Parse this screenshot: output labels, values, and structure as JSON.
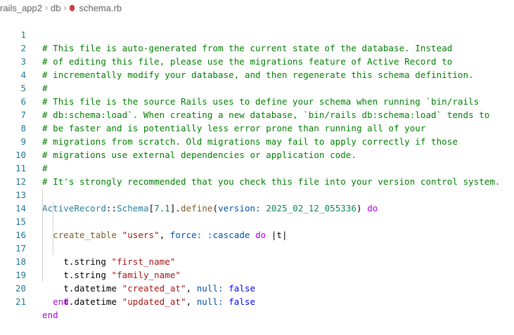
{
  "breadcrumb": {
    "items": [
      "rails_app2",
      "db"
    ],
    "file": "schema.rb",
    "separator": "›"
  },
  "colors": {
    "comment": "#008000",
    "keyword": "#af00db",
    "constant": "#267f99",
    "string": "#a31515",
    "number": "#098658",
    "line_number": "#237893"
  },
  "editor": {
    "lines": [
      {
        "n": "1",
        "t": "# This file is auto-generated from the current state of the database. Instead"
      },
      {
        "n": "2",
        "t": "# of editing this file, please use the migrations feature of Active Record to"
      },
      {
        "n": "3",
        "t": "# incrementally modify your database, and then regenerate this schema definition."
      },
      {
        "n": "4",
        "t": "#"
      },
      {
        "n": "5",
        "t": "# This file is the source Rails uses to define your schema when running `bin/rails"
      },
      {
        "n": "6",
        "t": "# db:schema:load`. When creating a new database, `bin/rails db:schema:load` tends to"
      },
      {
        "n": "7",
        "t": "# be faster and is potentially less error prone than running all of your"
      },
      {
        "n": "8",
        "t": "# migrations from scratch. Old migrations may fail to apply correctly if those"
      },
      {
        "n": "9",
        "t": "# migrations use external dependencies or application code."
      },
      {
        "n": "10",
        "t": "#"
      },
      {
        "n": "11",
        "t": "# It's strongly recommended that you check this file into your version control system."
      },
      {
        "n": "12",
        "t": ""
      },
      {
        "n": "13",
        "t": "ActiveRecord::Schema[7.1].define(version: 2025_02_12_055336) do"
      },
      {
        "n": "14",
        "t": "  create_table \"users\", force: :cascade do |t|"
      },
      {
        "n": "15",
        "t": "    t.string \"first_name\""
      },
      {
        "n": "16",
        "t": "    t.string \"family_name\""
      },
      {
        "n": "17",
        "t": "    t.datetime \"created_at\", null: false"
      },
      {
        "n": "18",
        "t": "    t.datetime \"updated_at\", null: false"
      },
      {
        "n": "19",
        "t": "  end"
      },
      {
        "n": "20",
        "t": ""
      },
      {
        "n": "21",
        "t": "end"
      }
    ],
    "tokens": {
      "l13_const": "ActiveRecord",
      "l13_sep": "::",
      "l13_schema": "Schema",
      "l13_open": "[",
      "l13_ver": "7.1",
      "l13_close": "].",
      "l13_define": "define",
      "l13_paren": "(",
      "l13_version_key": "version:",
      "l13_version_val": "2025_02_12_055336",
      "l13_paren_close": ")",
      "l13_do": "do",
      "l14_fn": "create_table",
      "l14_str": "\"users\"",
      "l14_comma": ",",
      "l14_force": "force:",
      "l14_cascade": ":cascade",
      "l14_do": "do",
      "l14_block": "|t|",
      "l15_t": "t.string",
      "l15_str": "\"first_name\"",
      "l16_t": "t.string",
      "l16_str": "\"family_name\"",
      "l17_t": "t.datetime",
      "l17_str": "\"created_at\"",
      "l17_comma": ",",
      "l17_null": "null:",
      "l17_false": "false",
      "l18_t": "t.datetime",
      "l18_str": "\"updated_at\"",
      "l18_comma": ",",
      "l18_null": "null:",
      "l18_false": "false",
      "l19_end": "end",
      "l21_end": "end"
    }
  }
}
